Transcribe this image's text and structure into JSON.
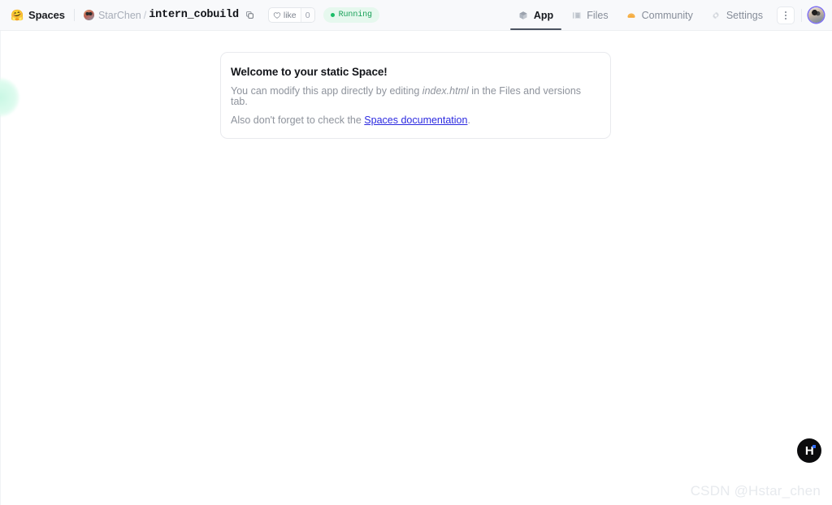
{
  "header": {
    "logo_icon": "hugging-face-emoji",
    "logo_glyph": "🤗",
    "product": "Spaces",
    "owner": "StarChen",
    "separator": "/",
    "repo": "intern_cobuild",
    "copy_icon": "copy-icon",
    "like": {
      "icon": "heart-icon",
      "label": "like",
      "count": "0"
    },
    "status": {
      "label": "Running",
      "color": "#18a058"
    },
    "tabs": [
      {
        "label": "App",
        "icon": "cube-icon",
        "active": true
      },
      {
        "label": "Files",
        "icon": "file-list-icon",
        "active": false
      },
      {
        "label": "Community",
        "icon": "community-icon",
        "active": false
      },
      {
        "label": "Settings",
        "icon": "gear-icon",
        "active": false
      }
    ],
    "more_menu_icon": "three-dots-vertical-icon",
    "user_avatar_icon": "user-avatar"
  },
  "main": {
    "card": {
      "title": "Welcome to your static Space!",
      "line1_before": "You can modify this app directly by editing ",
      "line1_file": "index.html",
      "line1_after": " in the Files and versions tab.",
      "line2_before": "Also don't forget to check the ",
      "line2_link": "Spaces documentation",
      "line2_after": "."
    }
  },
  "floating": {
    "widget_icon": "huggingface-h-badge",
    "letter": "H"
  },
  "watermark": {
    "text": "CSDN @Hstar_chen"
  }
}
